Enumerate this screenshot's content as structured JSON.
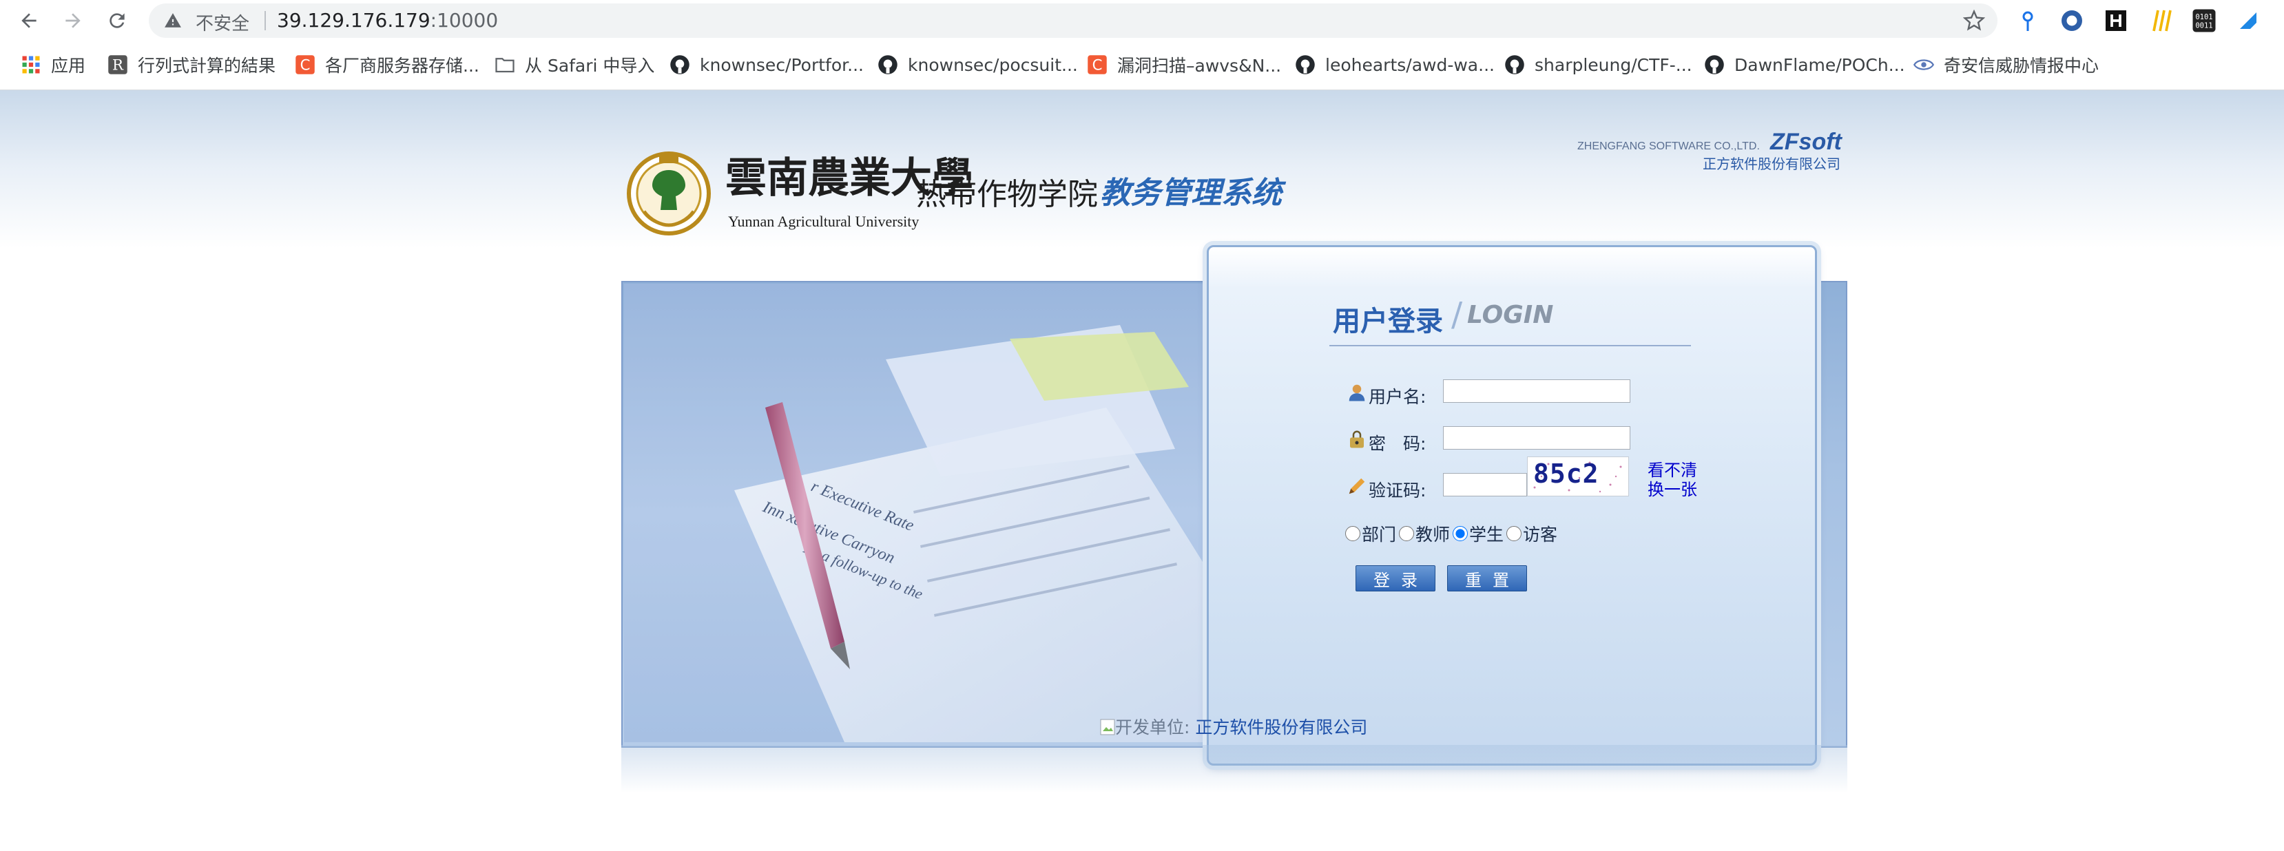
{
  "browser": {
    "security_label": "不安全",
    "url_host": "39.129.176.179",
    "url_port": ":10000",
    "bookmarks": [
      {
        "label": "应用",
        "icon": "apps-grid-icon"
      },
      {
        "label": "行列式計算的結果",
        "icon": "r-logo-icon"
      },
      {
        "label": "各厂商服务器存储...",
        "icon": "c-logo-icon"
      },
      {
        "label": "从 Safari 中导入",
        "icon": "folder-icon"
      },
      {
        "label": "knownsec/Portfor...",
        "icon": "github-icon"
      },
      {
        "label": "knownsec/pocsuit...",
        "icon": "github-icon"
      },
      {
        "label": "漏洞扫描–awvs&N...",
        "icon": "c-logo-icon"
      },
      {
        "label": "leohearts/awd-wa...",
        "icon": "github-icon"
      },
      {
        "label": "sharpleung/CTF-...",
        "icon": "github-icon"
      },
      {
        "label": "DawnFlame/POCh...",
        "icon": "github-icon"
      },
      {
        "label": "奇安信威胁情报中心",
        "icon": "eye-icon"
      }
    ],
    "colors": {
      "omnibox": "#f1f3f4",
      "bookmark_text": "#3c4043"
    }
  },
  "header": {
    "logo_text_cn": "雲南農業大學",
    "logo_text_en": "Yunnan Agricultural University",
    "logo_sub_cn": "热带作物学院",
    "system_name": "教务管理系统",
    "vendor_en": "ZHENGFANG SOFTWARE CO.,LTD.",
    "vendor_brand": "ZFsoft",
    "vendor_cn": "正方软件股份有限公司"
  },
  "banner": {
    "photo_text_1": "r Executive Rate",
    "photo_text_2": "Inn    xecutive Carryon",
    "photo_text_3": "As a follow-up to the"
  },
  "login": {
    "title": "用户登录",
    "title_en": "LOGIN",
    "username_label": "用户名:",
    "password_label": "密　码:",
    "captcha_label": "验证码:",
    "username_value": "",
    "password_value": "",
    "captcha_value": "",
    "captcha_image_text": "85c2",
    "refresh_line1": "看不清",
    "refresh_line2": "换一张",
    "roles": [
      "部门",
      "教师",
      "学生",
      "访客"
    ],
    "selected_role": "学生",
    "login_button": "登录",
    "reset_button": "重置",
    "colors": {
      "title": "#2b60b0",
      "button": "#2f66b6",
      "link": "#0000cc"
    }
  },
  "footer": {
    "broken_image_alt": "开发单位:",
    "org": "正方软件股份有限公司"
  }
}
